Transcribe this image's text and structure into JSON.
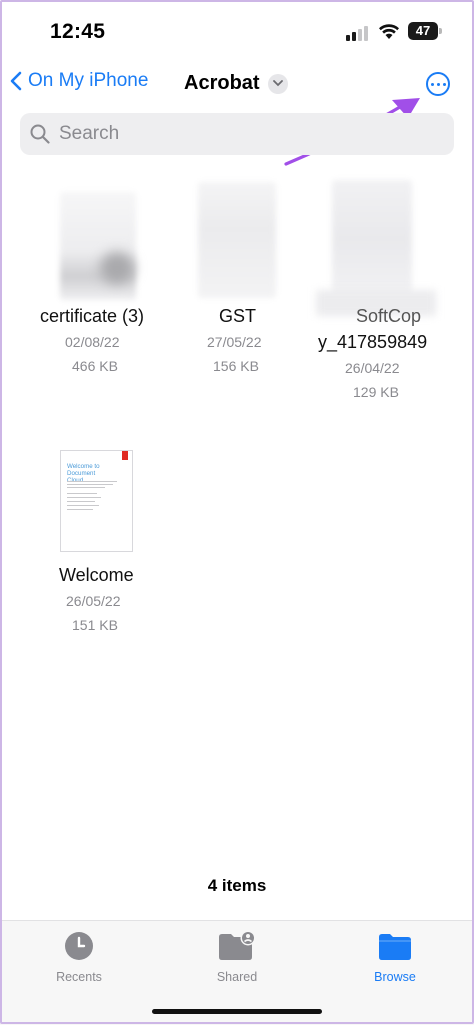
{
  "status_bar": {
    "time": "12:45",
    "battery": "47"
  },
  "nav": {
    "back_label": "On My iPhone",
    "title": "Acrobat"
  },
  "search": {
    "placeholder": "Search"
  },
  "files": [
    {
      "name": "certificate (3)",
      "date": "02/08/22",
      "size": "466 KB"
    },
    {
      "name": "GST",
      "date": "27/05/22",
      "size": "156 KB"
    },
    {
      "name_line1": "SoftCop",
      "name_line2": "y_417859849",
      "date": "26/04/22",
      "size": "129 KB"
    },
    {
      "name": "Welcome",
      "date": "26/05/22",
      "size": "151 KB",
      "thumb_heading": "Welcome to Document Cloud"
    }
  ],
  "item_count": "4 items",
  "tabs": [
    {
      "label": "Recents",
      "icon": "clock-icon"
    },
    {
      "label": "Shared",
      "icon": "shared-folder-icon"
    },
    {
      "label": "Browse",
      "icon": "folder-icon",
      "active": true
    }
  ],
  "colors": {
    "accent": "#1a7cf5",
    "annotation": "#a14fe8",
    "secondary_text": "#8a8a8f"
  }
}
